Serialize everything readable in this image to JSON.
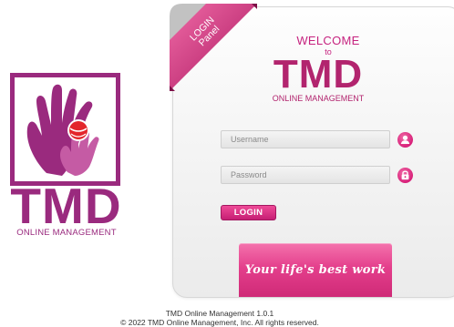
{
  "logo": {
    "title": "TMD",
    "subtitle": "ONLINE MANAGEMENT",
    "icon": "hands-with-globe-icon"
  },
  "panel": {
    "ribbon_line1": "LOGIN",
    "ribbon_line2": "Panel",
    "welcome": "WELCOME",
    "to": "to",
    "brand": "TMD",
    "brand_sub": "ONLINE MANAGEMENT"
  },
  "form": {
    "username_placeholder": "Username",
    "username_value": "",
    "password_placeholder": "Password",
    "password_value": "",
    "username_icon": "user-icon",
    "password_icon": "lock-icon",
    "login_label": "LOGIN"
  },
  "banner": {
    "tagline": "Your life's best work"
  },
  "footer": {
    "version": "TMD Online Management 1.0.1",
    "copyright": "© 2022 TMD Online Management, Inc. All rights reserved."
  },
  "colors": {
    "brand_purple": "#9a2a7e",
    "brand_pink": "#c6237f",
    "accent_pink": "#e43f8c"
  }
}
